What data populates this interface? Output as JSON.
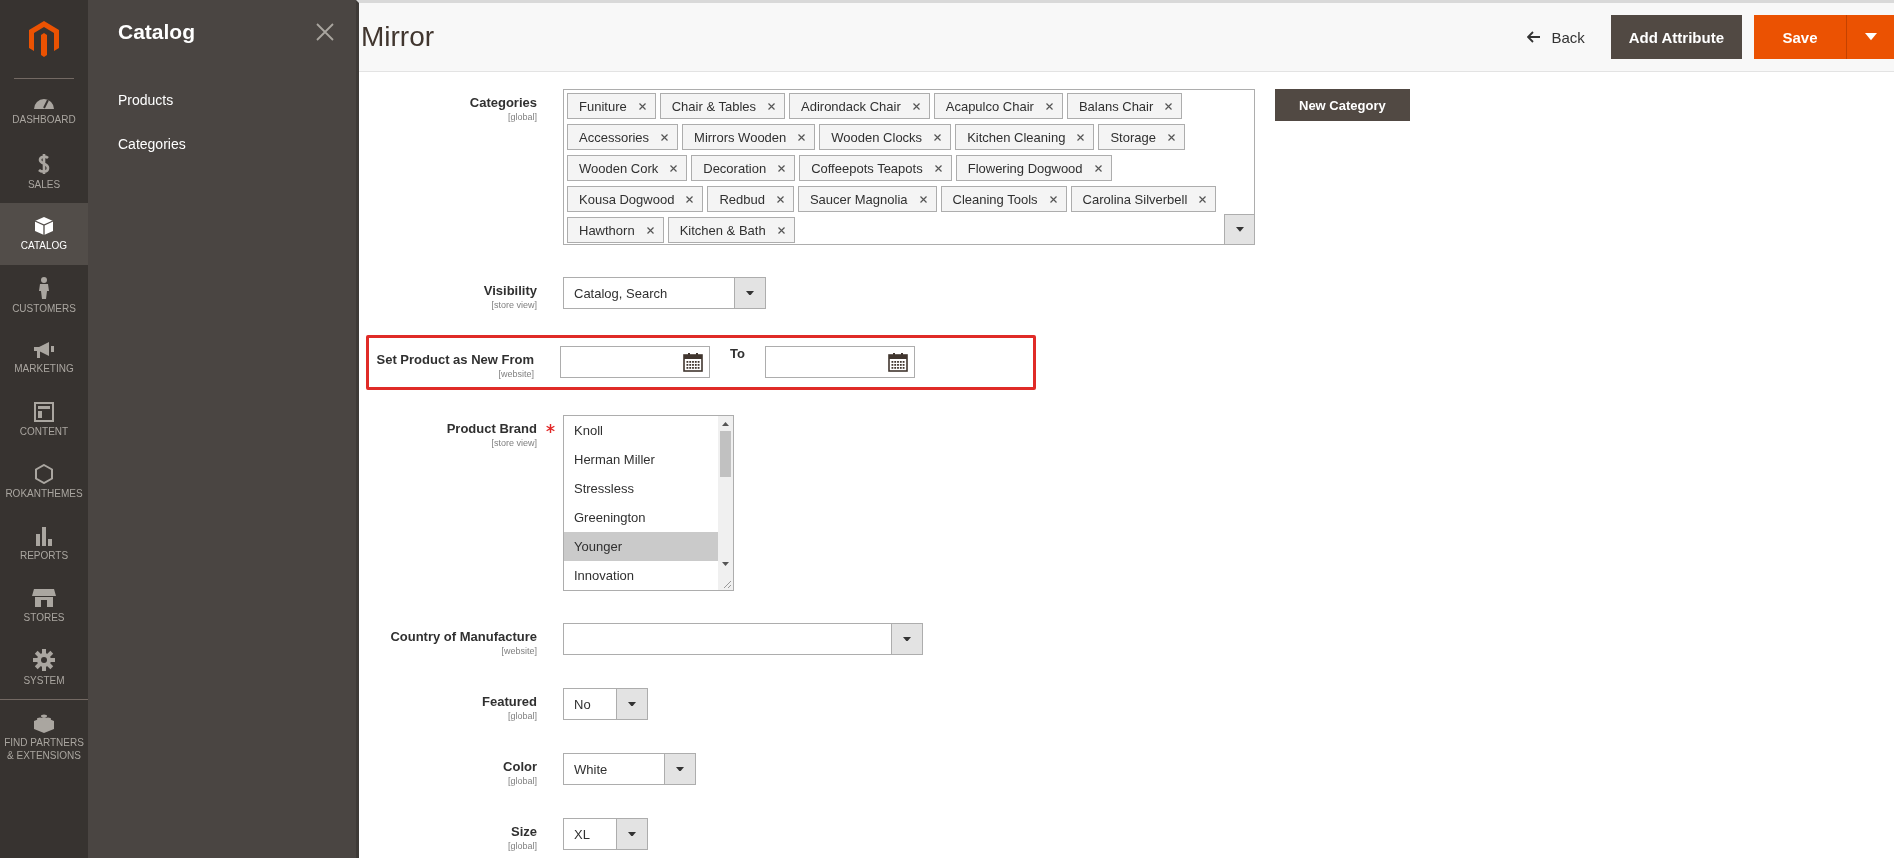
{
  "nav": {
    "items": [
      {
        "label": "DASHBOARD",
        "selected": false
      },
      {
        "label": "SALES",
        "selected": false
      },
      {
        "label": "CATALOG",
        "selected": true
      },
      {
        "label": "CUSTOMERS",
        "selected": false
      },
      {
        "label": "MARKETING",
        "selected": false
      },
      {
        "label": "CONTENT",
        "selected": false
      },
      {
        "label": "ROKANTHEMES",
        "selected": false
      },
      {
        "label": "REPORTS",
        "selected": false
      },
      {
        "label": "STORES",
        "selected": false
      },
      {
        "label": "SYSTEM",
        "selected": false
      },
      {
        "label": "FIND PARTNERS & EXTENSIONS",
        "selected": false
      }
    ]
  },
  "flyout": {
    "title": "Catalog",
    "items": [
      "Products",
      "Categories"
    ]
  },
  "header": {
    "title": "Mirror",
    "back": "Back",
    "add_attribute": "Add Attribute",
    "save": "Save"
  },
  "fields": [
    {
      "kind": "tags",
      "label": "Categories",
      "scope": "[global]",
      "required": false,
      "highlighted": false,
      "tags": [
        "Funiture",
        "Chair & Tables",
        "Adirondack Chair",
        "Acapulco Chair",
        "Balans Chair",
        "Accessories",
        "Mirrors Wooden",
        "Wooden Clocks",
        "Kitchen Cleaning",
        "Storage",
        "Wooden Cork",
        "Decoration",
        "Coffeepots Teapots",
        "Flowering Dogwood",
        "Kousa Dogwood",
        "Redbud",
        "Saucer Magnolia",
        "Cleaning Tools",
        "Carolina Silverbell",
        "Hawthorn",
        "Kitchen & Bath"
      ],
      "button": "New Category"
    },
    {
      "kind": "select",
      "label": "Visibility",
      "scope": "[store view]",
      "required": false,
      "highlighted": false,
      "value": "Catalog, Search"
    },
    {
      "kind": "daterange",
      "label": "Set Product as New From",
      "scope": "[website]",
      "required": false,
      "highlighted": true,
      "to_label": "To"
    },
    {
      "kind": "listbox",
      "label": "Product Brand",
      "scope": "[store view]",
      "required": true,
      "highlighted": false,
      "options": [
        {
          "label": "Knoll",
          "selected": false
        },
        {
          "label": "Herman Miller",
          "selected": false
        },
        {
          "label": "Stressless",
          "selected": false
        },
        {
          "label": "Greenington",
          "selected": false
        },
        {
          "label": "Younger",
          "selected": true
        },
        {
          "label": "Innovation",
          "selected": false
        }
      ]
    },
    {
      "kind": "select",
      "label": "Country of Manufacture",
      "scope": "[website]",
      "required": false,
      "highlighted": false
    },
    {
      "kind": "select",
      "label": "Featured",
      "scope": "[global]",
      "required": false,
      "highlighted": false,
      "value": "No"
    },
    {
      "kind": "select",
      "label": "Color",
      "scope": "[global]",
      "required": false,
      "highlighted": false,
      "value": "White"
    },
    {
      "kind": "select",
      "label": "Size",
      "scope": "[global]",
      "required": false,
      "highlighted": false,
      "value": "XL"
    }
  ]
}
